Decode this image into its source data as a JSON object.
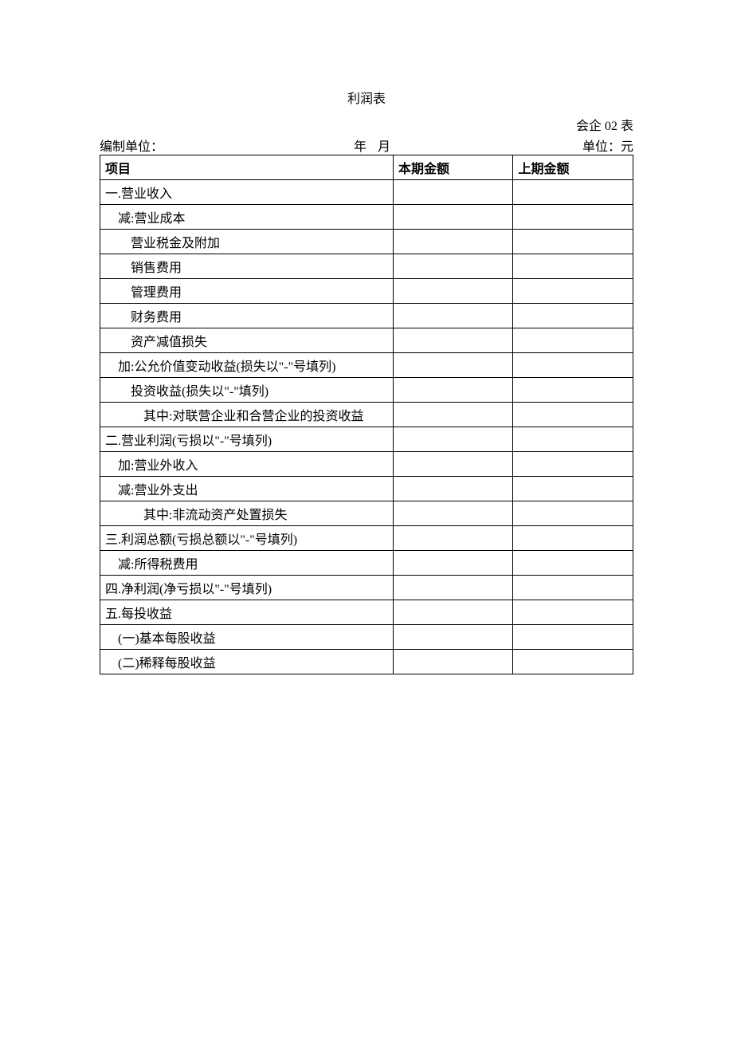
{
  "title": "利润表",
  "form_code": "会企 02 表",
  "header": {
    "compiled_by_label": "编制单位：",
    "year_label": "年",
    "month_label": "月",
    "unit_label": "单位：元"
  },
  "columns": {
    "item": "项目",
    "current": "本期金额",
    "previous": "上期金额"
  },
  "rows": [
    {
      "label": "一.营业收入",
      "indent": 0,
      "current": "",
      "previous": ""
    },
    {
      "label": "减:营业成本",
      "indent": 1,
      "current": "",
      "previous": ""
    },
    {
      "label": "营业税金及附加",
      "indent": 2,
      "current": "",
      "previous": ""
    },
    {
      "label": "销售费用",
      "indent": 2,
      "current": "",
      "previous": ""
    },
    {
      "label": "管理费用",
      "indent": 2,
      "current": "",
      "previous": ""
    },
    {
      "label": "财务费用",
      "indent": 2,
      "current": "",
      "previous": ""
    },
    {
      "label": "资产减值损失",
      "indent": 2,
      "current": "",
      "previous": ""
    },
    {
      "label": "加:公允价值变动收益(损失以\"-\"号填列)",
      "indent": 1,
      "current": "",
      "previous": ""
    },
    {
      "label": "投资收益(损失以\"-\"填列)",
      "indent": 2,
      "current": "",
      "previous": ""
    },
    {
      "label": "其中:对联营企业和合营企业的投资收益",
      "indent": 3,
      "current": "",
      "previous": ""
    },
    {
      "label": "二.营业利润(亏损以\"-\"号填列)",
      "indent": 0,
      "current": "",
      "previous": ""
    },
    {
      "label": "加:营业外收入",
      "indent": 1,
      "current": "",
      "previous": ""
    },
    {
      "label": "减:营业外支出",
      "indent": 1,
      "current": "",
      "previous": ""
    },
    {
      "label": "其中:非流动资产处置损失",
      "indent": 3,
      "current": "",
      "previous": ""
    },
    {
      "label": "三.利润总额(亏损总额以\"-\"号填列)",
      "indent": 0,
      "current": "",
      "previous": ""
    },
    {
      "label": "减:所得税费用",
      "indent": 1,
      "current": "",
      "previous": ""
    },
    {
      "label": "四.净利润(净亏损以\"-\"号填列)",
      "indent": 0,
      "current": "",
      "previous": ""
    },
    {
      "label": "五.每投收益",
      "indent": 0,
      "current": "",
      "previous": ""
    },
    {
      "label": "(一)基本每股收益",
      "indent": 1,
      "current": "",
      "previous": ""
    },
    {
      "label": "(二)稀释每股收益",
      "indent": 1,
      "current": "",
      "previous": ""
    }
  ]
}
